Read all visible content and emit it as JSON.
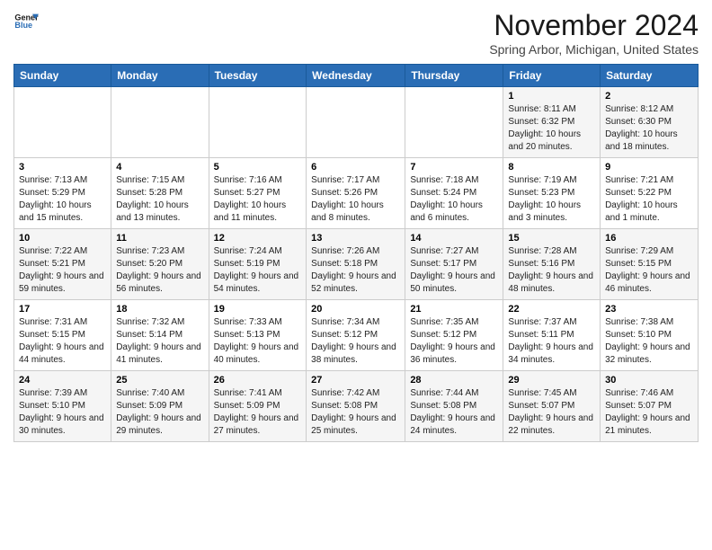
{
  "header": {
    "logo_line1": "General",
    "logo_line2": "Blue",
    "main_title": "November 2024",
    "subtitle": "Spring Arbor, Michigan, United States"
  },
  "days_of_week": [
    "Sunday",
    "Monday",
    "Tuesday",
    "Wednesday",
    "Thursday",
    "Friday",
    "Saturday"
  ],
  "weeks": [
    [
      {
        "day": "",
        "info": ""
      },
      {
        "day": "",
        "info": ""
      },
      {
        "day": "",
        "info": ""
      },
      {
        "day": "",
        "info": ""
      },
      {
        "day": "",
        "info": ""
      },
      {
        "day": "1",
        "info": "Sunrise: 8:11 AM\nSunset: 6:32 PM\nDaylight: 10 hours and 20 minutes."
      },
      {
        "day": "2",
        "info": "Sunrise: 8:12 AM\nSunset: 6:30 PM\nDaylight: 10 hours and 18 minutes."
      }
    ],
    [
      {
        "day": "3",
        "info": "Sunrise: 7:13 AM\nSunset: 5:29 PM\nDaylight: 10 hours and 15 minutes."
      },
      {
        "day": "4",
        "info": "Sunrise: 7:15 AM\nSunset: 5:28 PM\nDaylight: 10 hours and 13 minutes."
      },
      {
        "day": "5",
        "info": "Sunrise: 7:16 AM\nSunset: 5:27 PM\nDaylight: 10 hours and 11 minutes."
      },
      {
        "day": "6",
        "info": "Sunrise: 7:17 AM\nSunset: 5:26 PM\nDaylight: 10 hours and 8 minutes."
      },
      {
        "day": "7",
        "info": "Sunrise: 7:18 AM\nSunset: 5:24 PM\nDaylight: 10 hours and 6 minutes."
      },
      {
        "day": "8",
        "info": "Sunrise: 7:19 AM\nSunset: 5:23 PM\nDaylight: 10 hours and 3 minutes."
      },
      {
        "day": "9",
        "info": "Sunrise: 7:21 AM\nSunset: 5:22 PM\nDaylight: 10 hours and 1 minute."
      }
    ],
    [
      {
        "day": "10",
        "info": "Sunrise: 7:22 AM\nSunset: 5:21 PM\nDaylight: 9 hours and 59 minutes."
      },
      {
        "day": "11",
        "info": "Sunrise: 7:23 AM\nSunset: 5:20 PM\nDaylight: 9 hours and 56 minutes."
      },
      {
        "day": "12",
        "info": "Sunrise: 7:24 AM\nSunset: 5:19 PM\nDaylight: 9 hours and 54 minutes."
      },
      {
        "day": "13",
        "info": "Sunrise: 7:26 AM\nSunset: 5:18 PM\nDaylight: 9 hours and 52 minutes."
      },
      {
        "day": "14",
        "info": "Sunrise: 7:27 AM\nSunset: 5:17 PM\nDaylight: 9 hours and 50 minutes."
      },
      {
        "day": "15",
        "info": "Sunrise: 7:28 AM\nSunset: 5:16 PM\nDaylight: 9 hours and 48 minutes."
      },
      {
        "day": "16",
        "info": "Sunrise: 7:29 AM\nSunset: 5:15 PM\nDaylight: 9 hours and 46 minutes."
      }
    ],
    [
      {
        "day": "17",
        "info": "Sunrise: 7:31 AM\nSunset: 5:15 PM\nDaylight: 9 hours and 44 minutes."
      },
      {
        "day": "18",
        "info": "Sunrise: 7:32 AM\nSunset: 5:14 PM\nDaylight: 9 hours and 41 minutes."
      },
      {
        "day": "19",
        "info": "Sunrise: 7:33 AM\nSunset: 5:13 PM\nDaylight: 9 hours and 40 minutes."
      },
      {
        "day": "20",
        "info": "Sunrise: 7:34 AM\nSunset: 5:12 PM\nDaylight: 9 hours and 38 minutes."
      },
      {
        "day": "21",
        "info": "Sunrise: 7:35 AM\nSunset: 5:12 PM\nDaylight: 9 hours and 36 minutes."
      },
      {
        "day": "22",
        "info": "Sunrise: 7:37 AM\nSunset: 5:11 PM\nDaylight: 9 hours and 34 minutes."
      },
      {
        "day": "23",
        "info": "Sunrise: 7:38 AM\nSunset: 5:10 PM\nDaylight: 9 hours and 32 minutes."
      }
    ],
    [
      {
        "day": "24",
        "info": "Sunrise: 7:39 AM\nSunset: 5:10 PM\nDaylight: 9 hours and 30 minutes."
      },
      {
        "day": "25",
        "info": "Sunrise: 7:40 AM\nSunset: 5:09 PM\nDaylight: 9 hours and 29 minutes."
      },
      {
        "day": "26",
        "info": "Sunrise: 7:41 AM\nSunset: 5:09 PM\nDaylight: 9 hours and 27 minutes."
      },
      {
        "day": "27",
        "info": "Sunrise: 7:42 AM\nSunset: 5:08 PM\nDaylight: 9 hours and 25 minutes."
      },
      {
        "day": "28",
        "info": "Sunrise: 7:44 AM\nSunset: 5:08 PM\nDaylight: 9 hours and 24 minutes."
      },
      {
        "day": "29",
        "info": "Sunrise: 7:45 AM\nSunset: 5:07 PM\nDaylight: 9 hours and 22 minutes."
      },
      {
        "day": "30",
        "info": "Sunrise: 7:46 AM\nSunset: 5:07 PM\nDaylight: 9 hours and 21 minutes."
      }
    ]
  ]
}
